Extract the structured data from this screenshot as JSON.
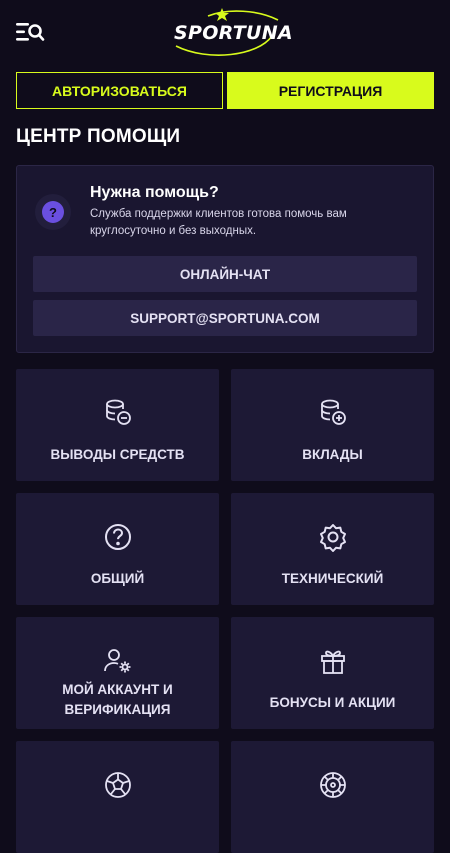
{
  "header": {
    "logo_text": "SPORTUNA",
    "menu_icon": "menu-search-icon"
  },
  "auth": {
    "login_label": "АВТОРИЗОВАТЬСЯ",
    "register_label": "РЕГИСТРАЦИЯ"
  },
  "page": {
    "title": "ЦЕНТР ПОМОЩИ"
  },
  "help": {
    "title": "Нужна помощь?",
    "description": "Служба поддержки клиентов готова помочь вам круглосуточно и без выходных.",
    "icon": "question-icon",
    "chat_label": "ОНЛАЙН-ЧАТ",
    "email_label": "SUPPORT@SPORTUNA.COM"
  },
  "categories": [
    {
      "label": "ВЫВОДЫ СРЕДСТВ",
      "icon": "coins-minus-icon"
    },
    {
      "label": "ВКЛАДЫ",
      "icon": "coins-plus-icon"
    },
    {
      "label": "ОБЩИЙ",
      "icon": "question-circle-icon"
    },
    {
      "label": "ТЕХНИЧЕСКИЙ",
      "icon": "gear-icon"
    },
    {
      "label": "МОЙ АККАУНТ И ВЕРИФИКАЦИЯ",
      "icon": "user-settings-icon"
    },
    {
      "label": "БОНУСЫ И АКЦИИ",
      "icon": "gift-icon"
    },
    {
      "label": "",
      "icon": "soccer-ball-icon"
    },
    {
      "label": "",
      "icon": "roulette-icon"
    }
  ],
  "colors": {
    "background": "#0f0c1b",
    "accent": "#d8fb1c",
    "card": "#1a1630",
    "tile": "#1d1935",
    "help_icon": "#6a4fe0"
  }
}
